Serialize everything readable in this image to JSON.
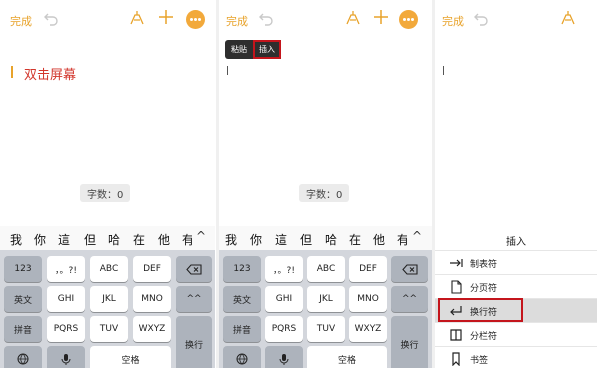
{
  "toolbar": {
    "done": "完成"
  },
  "panel1": {
    "doc_text": "双击屏幕",
    "word_count": "字数：0"
  },
  "panel2": {
    "popup": {
      "paste": "粘贴",
      "insert": "插入"
    },
    "word_count": "字数：0"
  },
  "keyboard": {
    "candidates": [
      "我",
      "你",
      "這",
      "但",
      "哈",
      "在",
      "他",
      "有"
    ],
    "chevron": "^",
    "rows": {
      "row1": [
        "123",
        "，。?!",
        "ABC",
        "DEF"
      ],
      "row2": [
        "英文",
        "GHI",
        "JKL",
        "MNO",
        "^^"
      ],
      "row3": [
        "拼音",
        "PQRS",
        "TUV",
        "WXYZ",
        "换行"
      ],
      "row4": [
        "空格"
      ]
    }
  },
  "insert_panel": {
    "title": "插入",
    "items": [
      {
        "label": "制表符",
        "icon": "tab-icon"
      },
      {
        "label": "分页符",
        "icon": "page-break-icon"
      },
      {
        "label": "换行符",
        "icon": "line-break-icon",
        "selected": true
      },
      {
        "label": "分栏符",
        "icon": "column-break-icon"
      },
      {
        "label": "书签",
        "icon": "bookmark-icon"
      }
    ]
  },
  "colors": {
    "accent": "#e8a32b",
    "highlight_red": "#c4151c",
    "text_red": "#d2362c"
  }
}
